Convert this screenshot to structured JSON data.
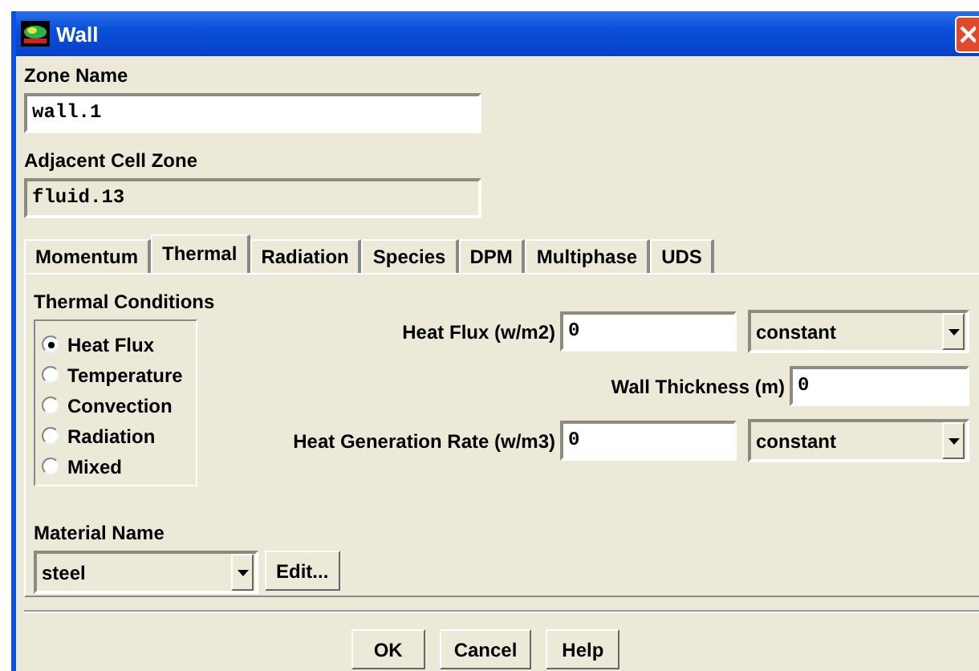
{
  "window": {
    "title": "Wall"
  },
  "zone_name": {
    "label": "Zone Name",
    "value": "wall.1"
  },
  "adjacent_cell_zone": {
    "label": "Adjacent Cell Zone",
    "value": "fluid.13"
  },
  "tabs": [
    {
      "label": "Momentum",
      "selected": false
    },
    {
      "label": "Thermal",
      "selected": true
    },
    {
      "label": "Radiation",
      "selected": false
    },
    {
      "label": "Species",
      "selected": false
    },
    {
      "label": "DPM",
      "selected": false
    },
    {
      "label": "Multiphase",
      "selected": false
    },
    {
      "label": "UDS",
      "selected": false
    }
  ],
  "thermal_conditions": {
    "label": "Thermal Conditions",
    "options": [
      {
        "label": "Heat Flux",
        "selected": true
      },
      {
        "label": "Temperature",
        "selected": false
      },
      {
        "label": "Convection",
        "selected": false
      },
      {
        "label": "Radiation",
        "selected": false
      },
      {
        "label": "Mixed",
        "selected": false
      }
    ]
  },
  "parameters": [
    {
      "label": "Heat Flux (w/m2)",
      "value": "0",
      "profile": "constant"
    },
    {
      "label": "Wall Thickness (m)",
      "value": "0"
    },
    {
      "label": "Heat Generation Rate (w/m3)",
      "value": "0",
      "profile": "constant"
    }
  ],
  "material": {
    "label": "Material Name",
    "value": "steel",
    "edit_button": "Edit..."
  },
  "buttons": [
    "OK",
    "Cancel",
    "Help"
  ]
}
